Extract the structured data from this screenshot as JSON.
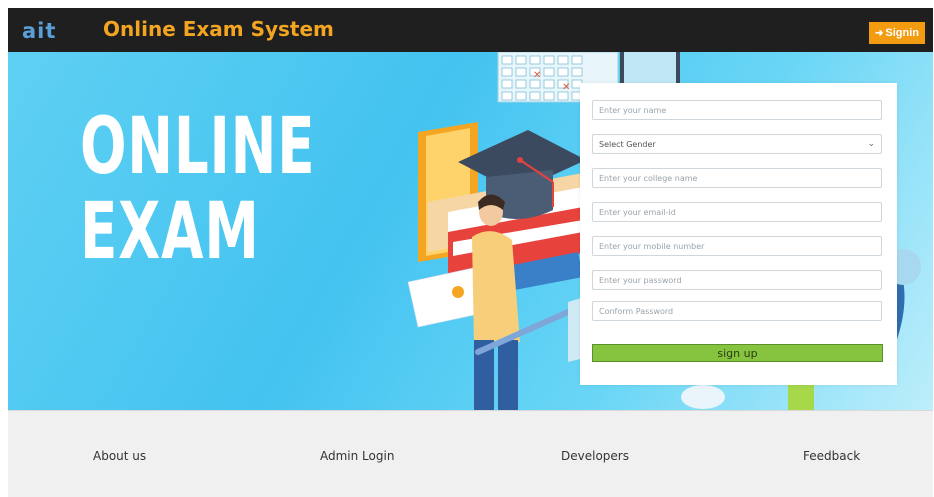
{
  "header": {
    "logo_text": "ait",
    "title": "Online Exam System",
    "signin_label": "Signin"
  },
  "hero": {
    "line1": "ONLINE",
    "line2": "EXAM"
  },
  "form": {
    "name_placeholder": "Enter your name",
    "gender_selected": "Select Gender",
    "college_placeholder": "Enter your college name",
    "email_placeholder": "Enter your email-id",
    "mobile_placeholder": "Enter your mobile number",
    "password_placeholder": "Enter your password",
    "confirm_placeholder": "Conform Password",
    "signup_label": "sign up"
  },
  "footer": {
    "links": [
      "About us",
      "Admin Login",
      "Developers",
      "Feedback"
    ]
  },
  "colors": {
    "header_bg": "#1f1f1f",
    "title_accent": "#f2a521",
    "signin_bg": "#f39c12",
    "hero_bg": "#43c3f0",
    "signup_bg": "#86c440",
    "footer_bg": "#f0f0f0"
  }
}
